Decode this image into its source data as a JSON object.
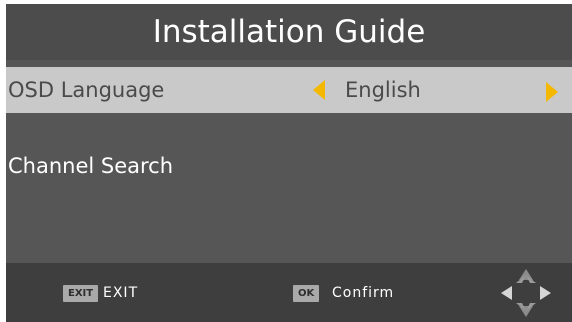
{
  "header": {
    "title": "Installation Guide"
  },
  "menu": {
    "items": [
      {
        "label": "OSD Language",
        "value": "English",
        "selected": true
      },
      {
        "label": "Channel Search",
        "selected": false
      }
    ]
  },
  "footer": {
    "exit_key": "EXIT",
    "exit_label": "EXIT",
    "ok_key": "OK",
    "ok_label": "Confirm"
  },
  "icons": {
    "left_arrow": "left-arrow-icon",
    "right_arrow": "right-arrow-icon",
    "navigation": "dpad-icon"
  },
  "colors": {
    "accent": "#f5b800",
    "panel": "#555655",
    "header": "#4c4c4c",
    "footer": "#3e3e3e",
    "selected_row": "#c9c9c9"
  }
}
